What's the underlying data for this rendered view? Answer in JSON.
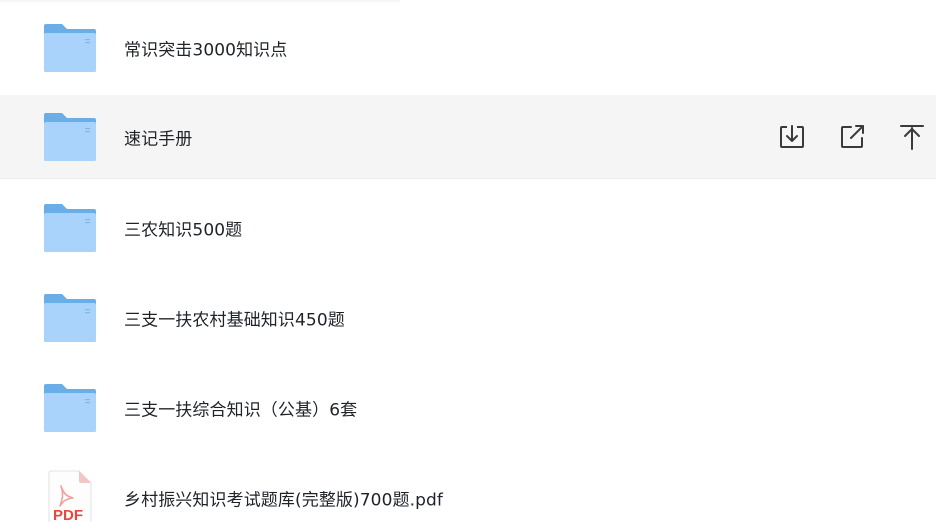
{
  "files": [
    {
      "name": "常识突击3000知识点",
      "type": "folder",
      "icon": "folder-icon"
    },
    {
      "name": "速记手册",
      "type": "folder",
      "icon": "folder-icon",
      "hovered": true
    },
    {
      "name": "三农知识500题",
      "type": "folder",
      "icon": "folder-icon"
    },
    {
      "name": "三支一扶农村基础知识450题",
      "type": "folder",
      "icon": "folder-icon"
    },
    {
      "name": "三支一扶综合知识（公基）6套",
      "type": "folder",
      "icon": "folder-icon"
    },
    {
      "name": "乡村振兴知识考试题库(完整版)700题.pdf",
      "type": "pdf",
      "icon": "pdf-file-icon",
      "badge": "PDF"
    }
  ],
  "row_actions": [
    {
      "icon": "download-icon"
    },
    {
      "icon": "share-icon"
    },
    {
      "icon": "pin-to-top-icon"
    }
  ],
  "colors": {
    "folder_back": "#6aaee8",
    "folder_front": "#a9d3fb",
    "hover_background": "#f5f5f5",
    "text": "#1f2329",
    "action_icon": "#3a3a3a",
    "pdf_red": "#e8473f"
  }
}
